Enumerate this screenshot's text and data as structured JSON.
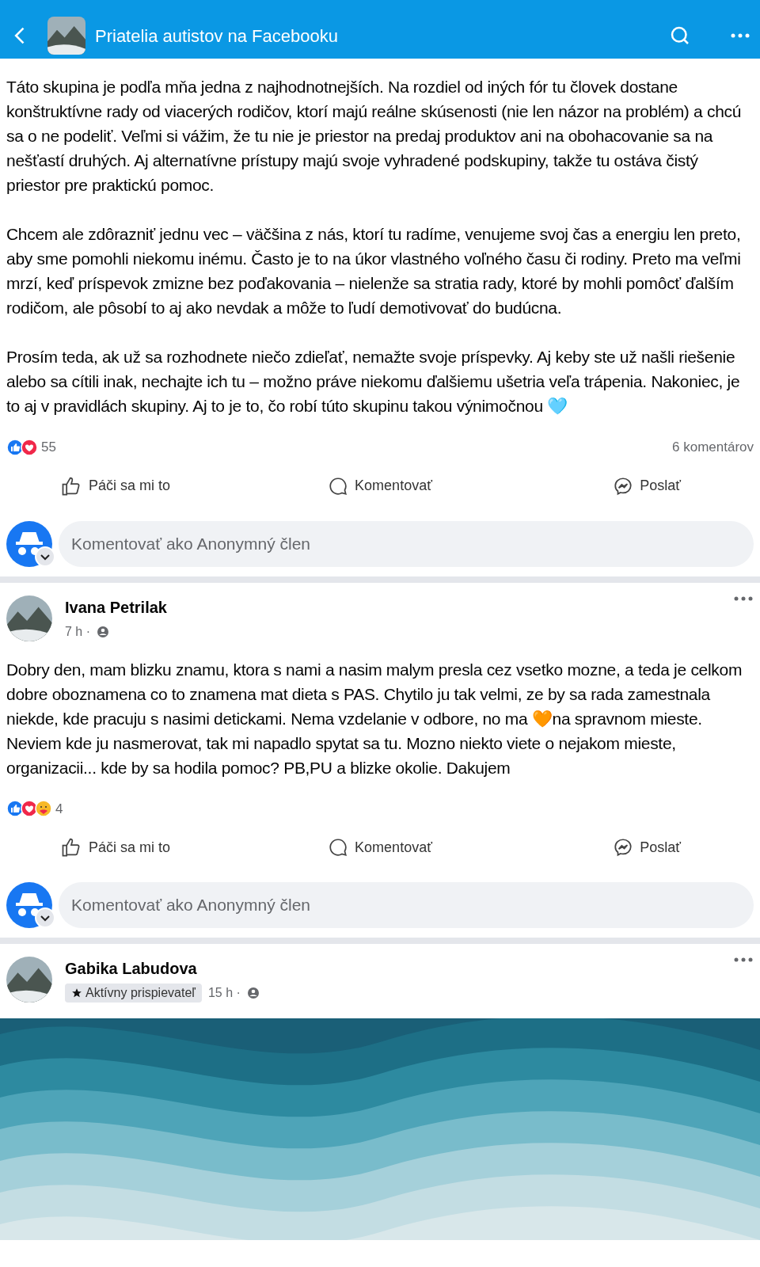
{
  "header": {
    "title": "Priatelia autistov na Facebooku"
  },
  "posts": [
    {
      "paragraphs": [
        "Táto skupina je podľa mňa jedna z najhodnotnejších. Na rozdiel od iných fór tu človek dostane konštruktívne rady od viacerých rodičov, ktorí majú reálne skúsenosti (nie len názor na problém) a chcú sa o ne podeliť. Veľmi si vážim, že tu nie je priestor na predaj produktov ani na obohacovanie sa na nešťastí druhých. Aj alternatívne prístupy majú svoje vyhradené podskupiny, takže tu ostáva čistý priestor pre praktickú pomoc.",
        "Chcem ale zdôrazniť jednu vec – väčšina z nás, ktorí tu radíme, venujeme svoj čas a energiu len preto, aby sme pomohli niekomu inému. Často je to na úkor vlastného voľného času či rodiny. Preto ma veľmi mrzí, keď príspevok zmizne bez poďakovania – nielenže sa stratia rady, ktoré by mohli pomôcť ďalším rodičom, ale pôsobí to aj ako nevdak a môže to ľudí demotivovať do budúcna.",
        "Prosím teda, ak už sa rozhodnete niečo zdieľať, nemažte svoje príspevky. Aj keby ste už našli riešenie alebo sa cítili inak, nechajte ich tu – možno práve niekomu ďalšiemu ušetria veľa trápenia. Nakoniec, je to aj v pravidlách skupiny. Aj to je to, čo robí túto skupinu takou výnimočnou 🩵"
      ],
      "reactions": [
        {
          "kind": "like"
        },
        {
          "kind": "love"
        }
      ],
      "reaction_count": "55",
      "comments": "6 komentárov",
      "actions": [
        "Páči sa mi to",
        "Komentovať",
        "Poslať"
      ],
      "comment_placeholder": "Komentovať ako Anonymný člen"
    },
    {
      "author": "Ivana Petrilak",
      "time": "7 h ·",
      "paragraphs": [
        "Dobry den, mam blizku znamu, ktora s nami a nasim malym presla cez vsetko mozne, a teda je celkom dobre oboznamena co to znamena mat dieta s PAS. Chytilo ju tak velmi, ze by sa rada zamestnala niekde, kde pracuju s nasimi detickami. Nema vzdelanie v odbore, no ma 🧡na spravnom mieste. Neviem kde ju nasmerovat, tak mi napadlo spytat sa tu. Mozno niekto viete o nejakom mieste, organizacii... kde by sa hodila pomoc? PB,PU a blizke okolie. Dakujem"
      ],
      "reactions": [
        {
          "kind": "like"
        },
        {
          "kind": "love"
        },
        {
          "kind": "care"
        }
      ],
      "reaction_count": "4",
      "actions": [
        "Páči sa mi to",
        "Komentovať",
        "Poslať"
      ],
      "comment_placeholder": "Komentovať ako Anonymný člen"
    },
    {
      "author": "Gabika Labudova",
      "time": "15 h ·",
      "badge": "Aktívny prispievateľ"
    }
  ]
}
